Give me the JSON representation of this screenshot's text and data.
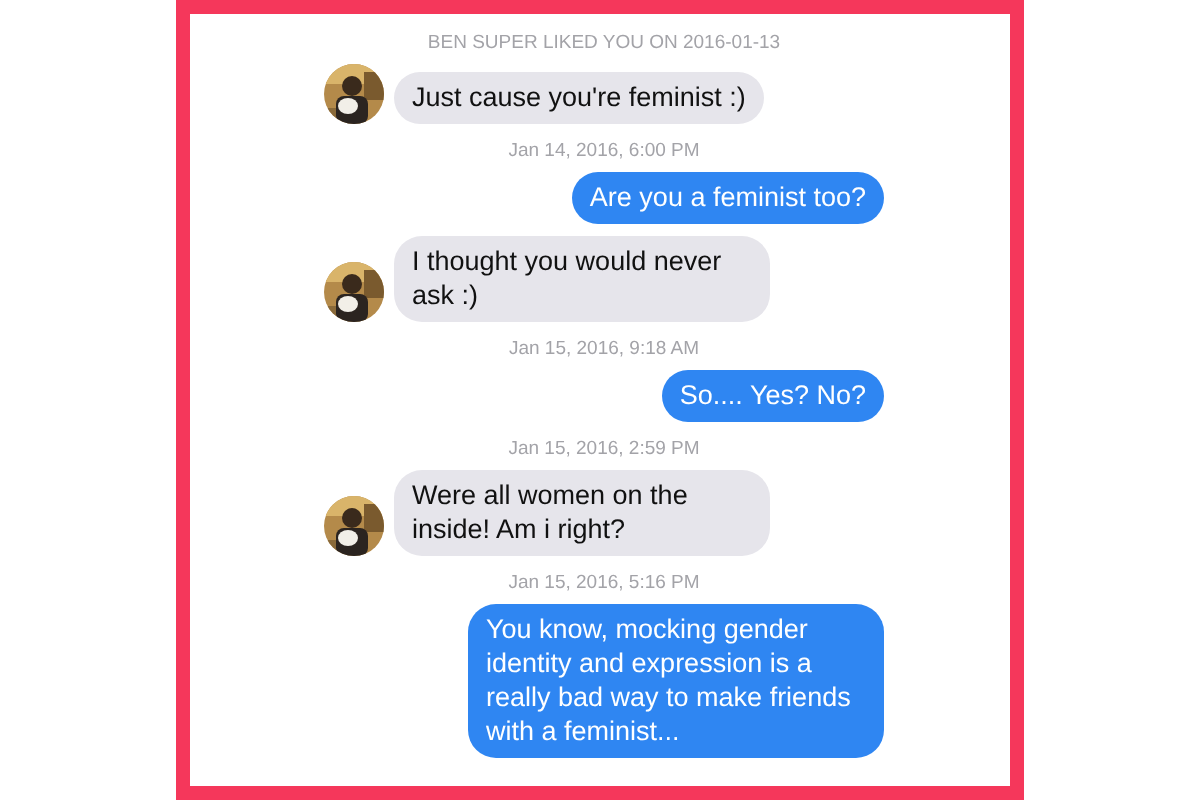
{
  "notice": "BEN SUPER LIKED YOU ON 2016-01-13",
  "items": [
    {
      "kind": "received",
      "text": "Just cause you're feminist :)"
    },
    {
      "kind": "timestamp",
      "text": "Jan 14, 2016, 6:00 PM"
    },
    {
      "kind": "sent",
      "text": "Are you a feminist too?"
    },
    {
      "kind": "received",
      "text": "I thought you would never ask :)"
    },
    {
      "kind": "timestamp",
      "text": "Jan 15, 2016, 9:18 AM"
    },
    {
      "kind": "sent",
      "text": "So.... Yes? No?"
    },
    {
      "kind": "timestamp",
      "text": "Jan 15, 2016, 2:59 PM"
    },
    {
      "kind": "received",
      "text": "Were all women on the inside! Am i right?"
    },
    {
      "kind": "timestamp",
      "text": "Jan 15, 2016, 5:16 PM"
    },
    {
      "kind": "sent",
      "text": "You know, mocking gender identity and expression is a really bad way to make friends with a feminist..."
    }
  ]
}
